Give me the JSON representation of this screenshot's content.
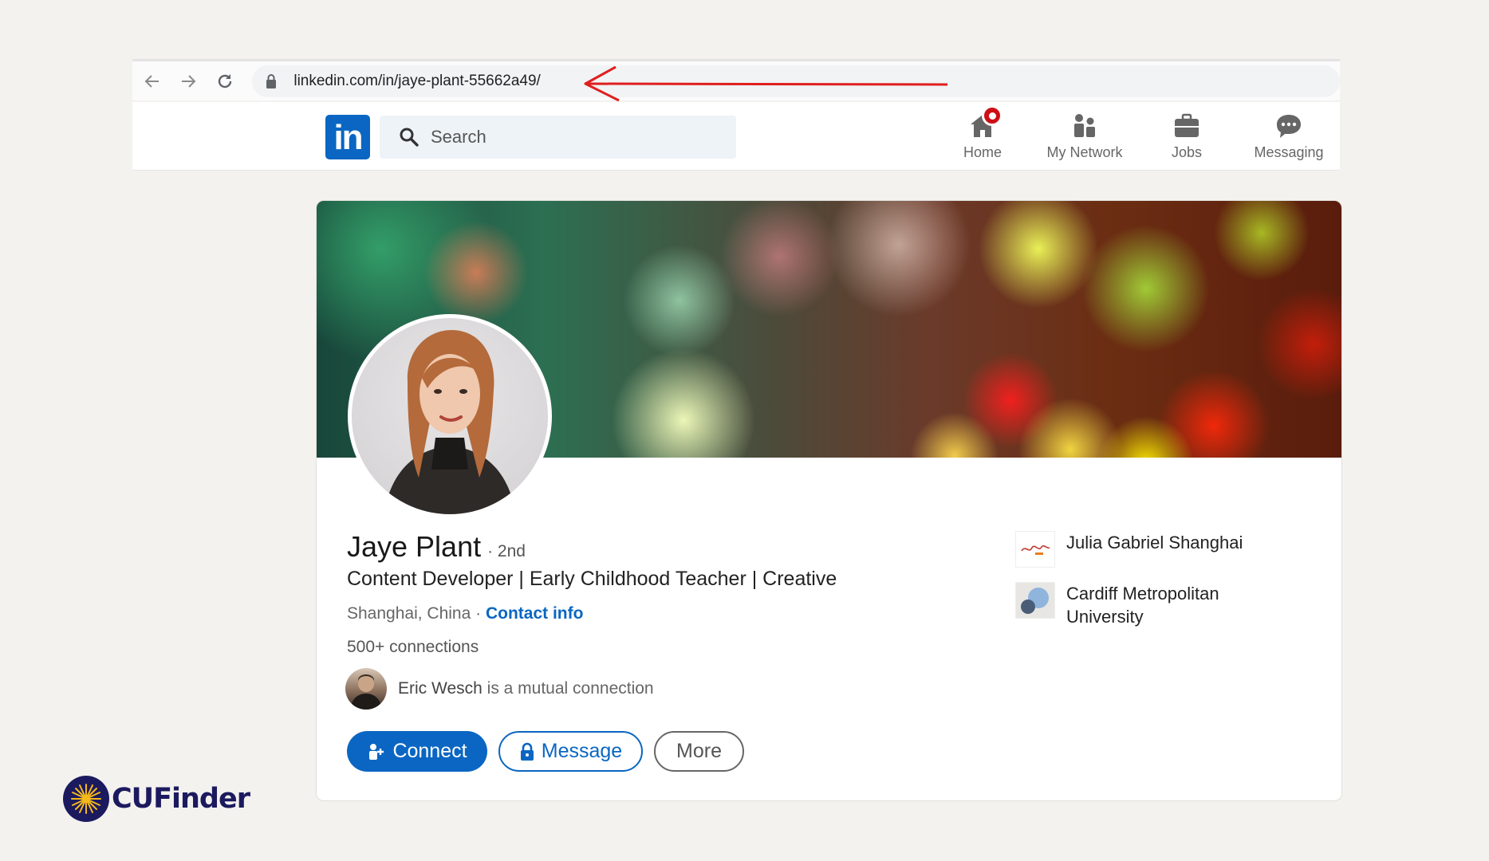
{
  "browser": {
    "url": "linkedin.com/in/jaye-plant-55662a49/"
  },
  "linkedin": {
    "logo_text": "in",
    "search_placeholder": "Search",
    "nav": [
      {
        "label": "Home",
        "icon": "home-icon"
      },
      {
        "label": "My Network",
        "icon": "network-icon"
      },
      {
        "label": "Jobs",
        "icon": "briefcase-icon"
      },
      {
        "label": "Messaging",
        "icon": "messaging-icon"
      }
    ]
  },
  "profile": {
    "name": "Jaye Plant",
    "degree": "· 2nd",
    "headline": "Content Developer | Early Childhood Teacher | Creative",
    "location": "Shanghai, China",
    "separator": " · ",
    "contact_label": "Contact info",
    "connections": "500+ connections",
    "mutual_name": "Eric Wesch",
    "mutual_suffix": " is a mutual connection",
    "buttons": {
      "connect": "Connect",
      "message": "Message",
      "more": "More"
    },
    "entities": [
      {
        "name": "Julia Gabriel Shanghai"
      },
      {
        "name": "Cardiff Metropolitan University"
      }
    ]
  },
  "watermark": {
    "brand": "CUFinder"
  },
  "colors": {
    "linkedin_blue": "#0a66c2",
    "notification_red": "#cc1016",
    "annotation_red": "#e01e1e",
    "brand_navy": "#1c1a5e"
  }
}
